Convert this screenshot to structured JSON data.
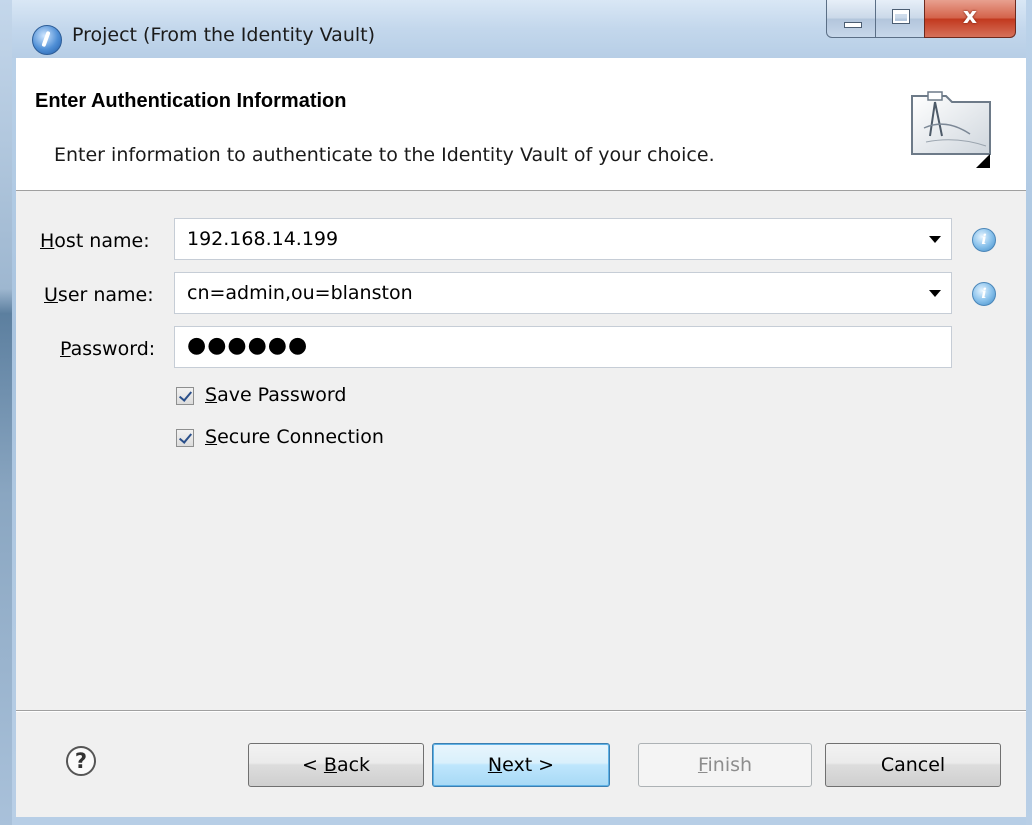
{
  "window": {
    "title": "Project (From the Identity Vault)",
    "close_glyph": "x"
  },
  "banner": {
    "title": "Enter Authentication Information",
    "description": "Enter information to authenticate to the Identity Vault of your choice."
  },
  "form": {
    "host": {
      "label_key": "H",
      "label_rest": "ost name:",
      "value": "192.168.14.199"
    },
    "user": {
      "label_key": "U",
      "label_rest": "ser name:",
      "value": "cn=admin,ou=blanston"
    },
    "password": {
      "label_key": "P",
      "label_rest": "assword:",
      "masked_value": "●●●●●●"
    },
    "save_password": {
      "key": "S",
      "rest": "ave Password",
      "checked": true
    },
    "secure_connection": {
      "key": "S",
      "rest": "ecure Connection",
      "checked": true
    }
  },
  "buttons": {
    "back": {
      "prefix": "< ",
      "key": "B",
      "rest": "ack"
    },
    "next": {
      "key": "N",
      "rest": "ext >"
    },
    "finish": {
      "key": "F",
      "rest": "inish",
      "enabled": false
    },
    "cancel": {
      "label": "Cancel"
    }
  },
  "icons": {
    "info": "i",
    "help": "?"
  },
  "colors": {
    "next_button_accent": "#3c7fb1",
    "close_button": "#c2391f"
  }
}
